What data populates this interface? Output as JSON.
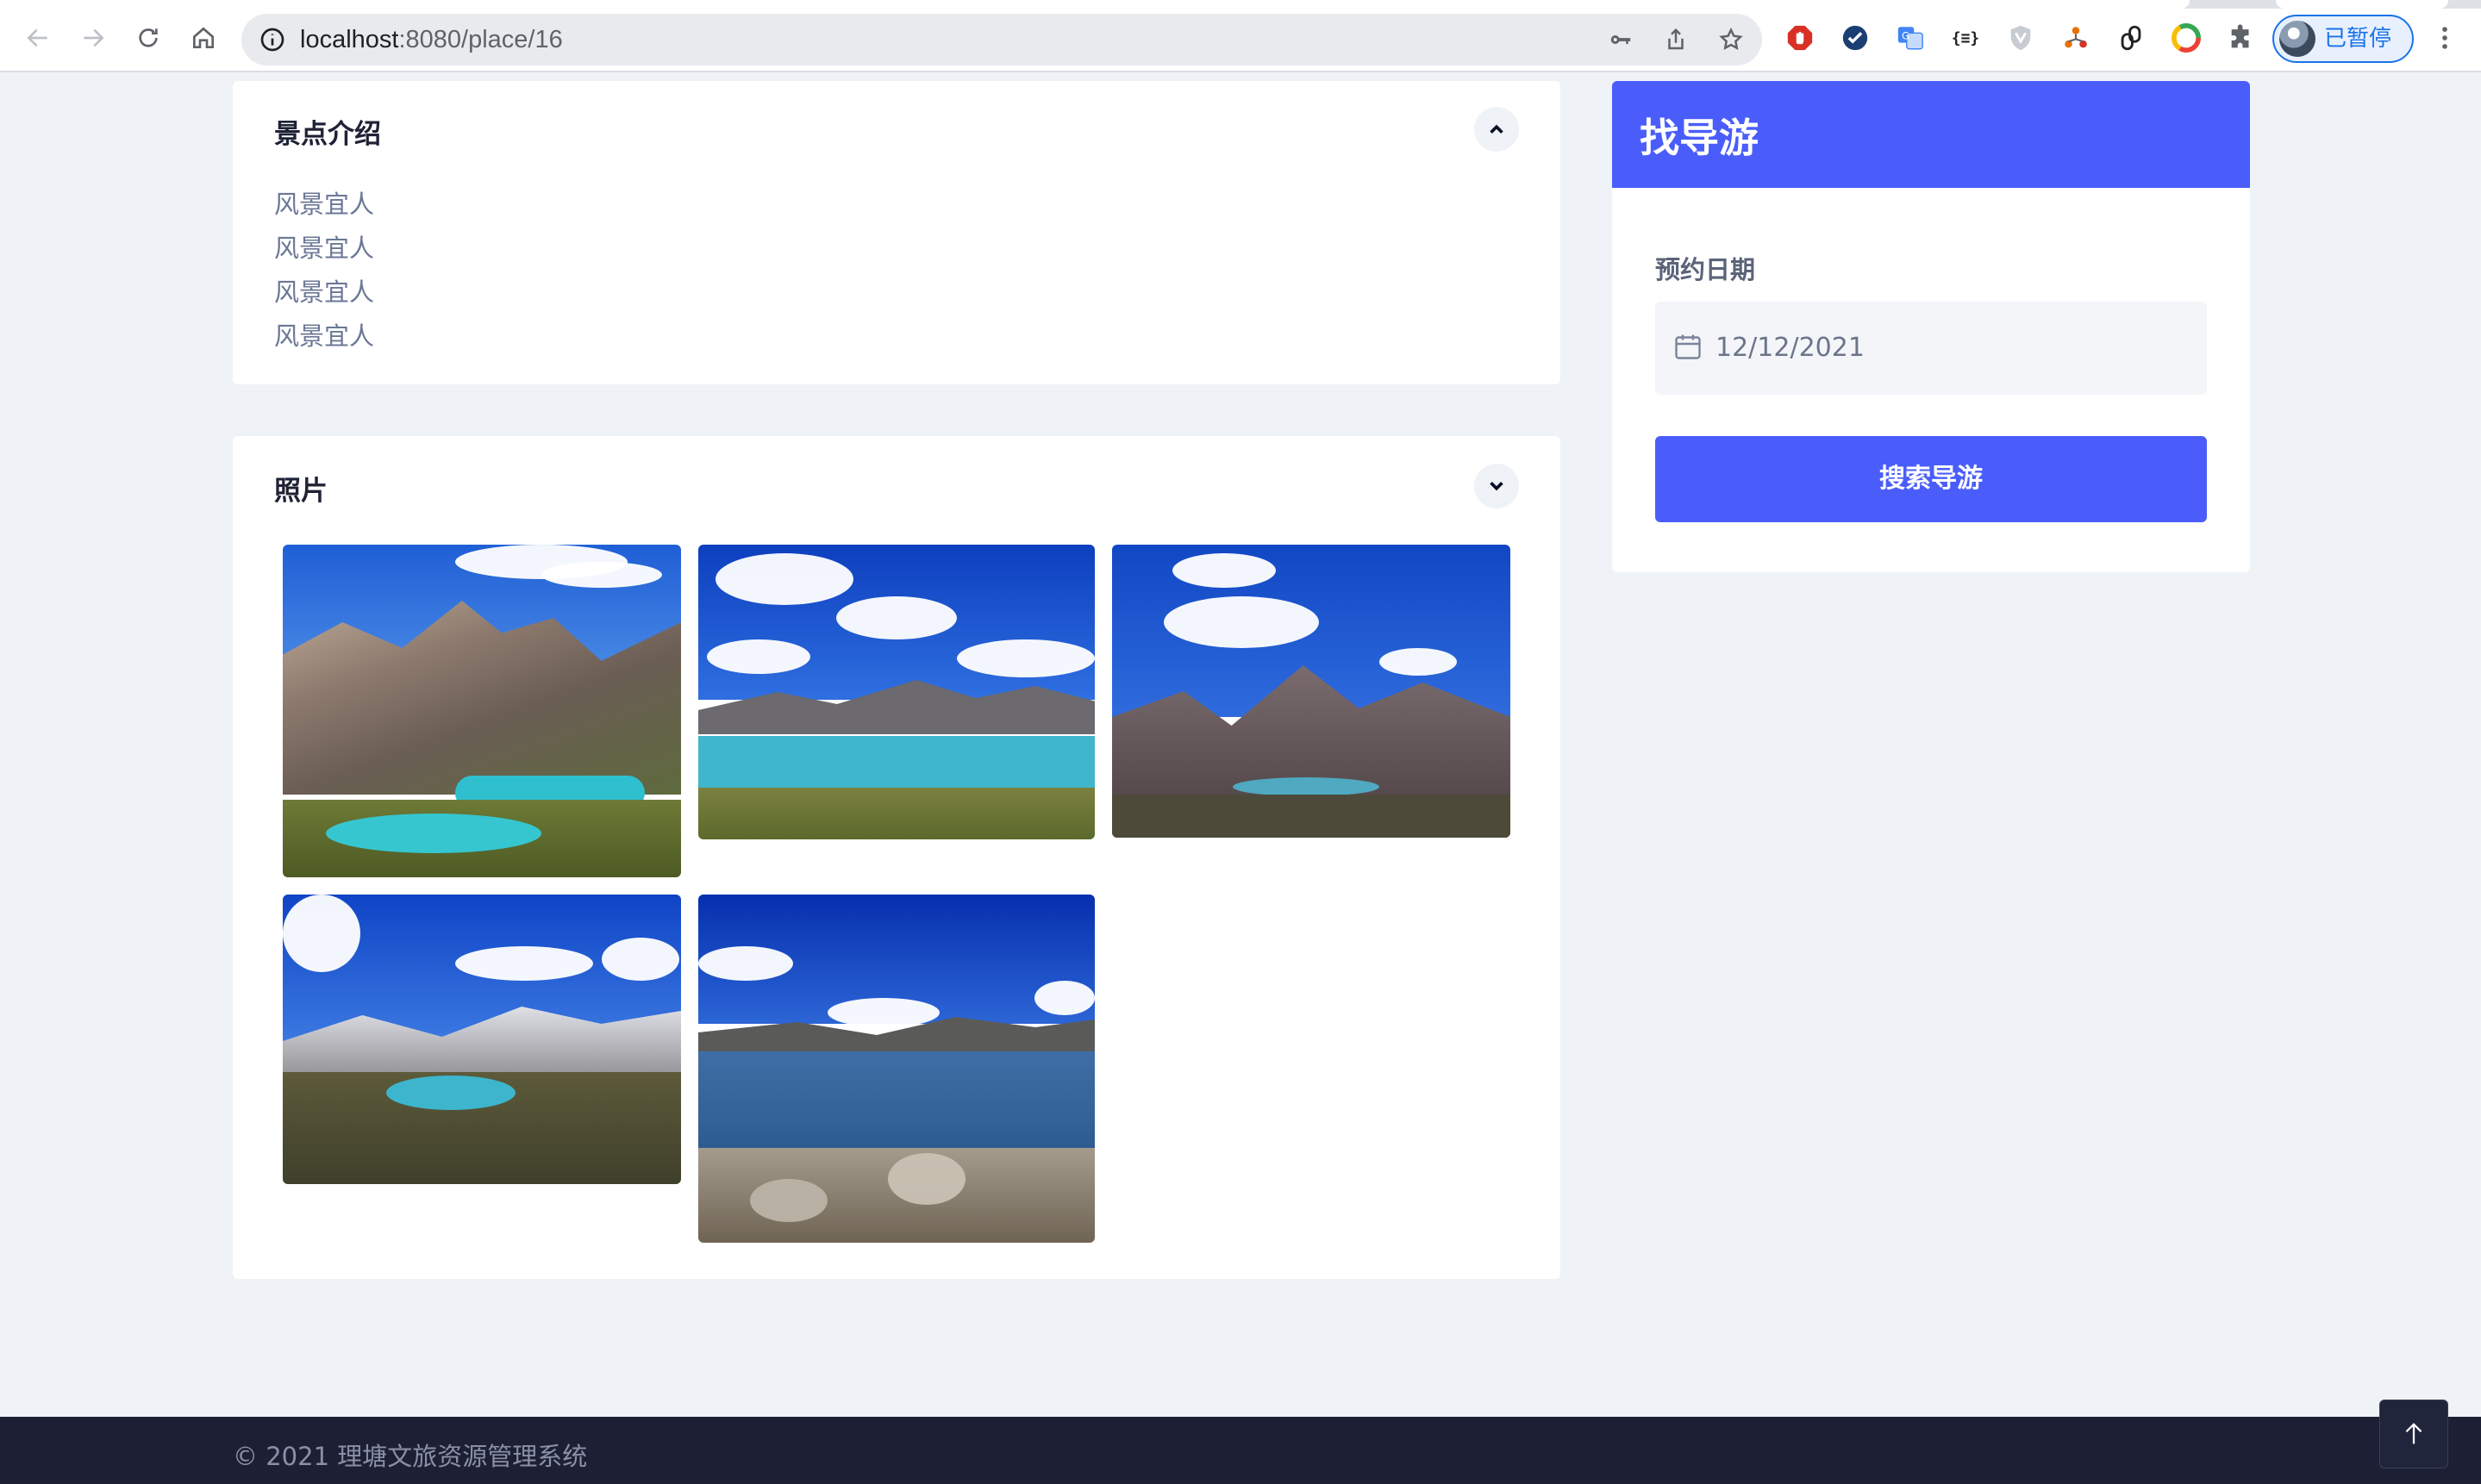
{
  "browser": {
    "url_host": "localhost",
    "url_rest": ":8080/place/16",
    "profile_status": "已暂停",
    "extension_json_label": "{≡}"
  },
  "intro": {
    "title": "景点介绍",
    "lines": [
      "风景宜人",
      "风景宜人",
      "风景宜人",
      "风景宜人"
    ]
  },
  "photos": {
    "title": "照片",
    "count": 5
  },
  "guide": {
    "title": "找导游",
    "date_label": "预约日期",
    "date_value": "12/12/2021",
    "search_label": "搜索导游"
  },
  "footer": {
    "copyright": "© 2021 理塘文旅资源管理系统"
  },
  "colors": {
    "accent": "#4a5dfb",
    "page_bg": "#eff2f7",
    "footer_bg": "#1d2034"
  },
  "icons": {
    "back": "arrow-left-icon",
    "forward": "arrow-right-icon",
    "reload": "reload-icon",
    "home": "home-icon",
    "site_info": "info-icon",
    "password": "key-icon",
    "share": "share-icon",
    "bookmark": "star-icon",
    "extensions": "puzzle-icon",
    "menu": "more-vertical-icon",
    "collapse": "chevron-up-icon",
    "expand": "chevron-down-icon",
    "calendar": "calendar-icon",
    "back_to_top": "arrow-up-icon"
  }
}
